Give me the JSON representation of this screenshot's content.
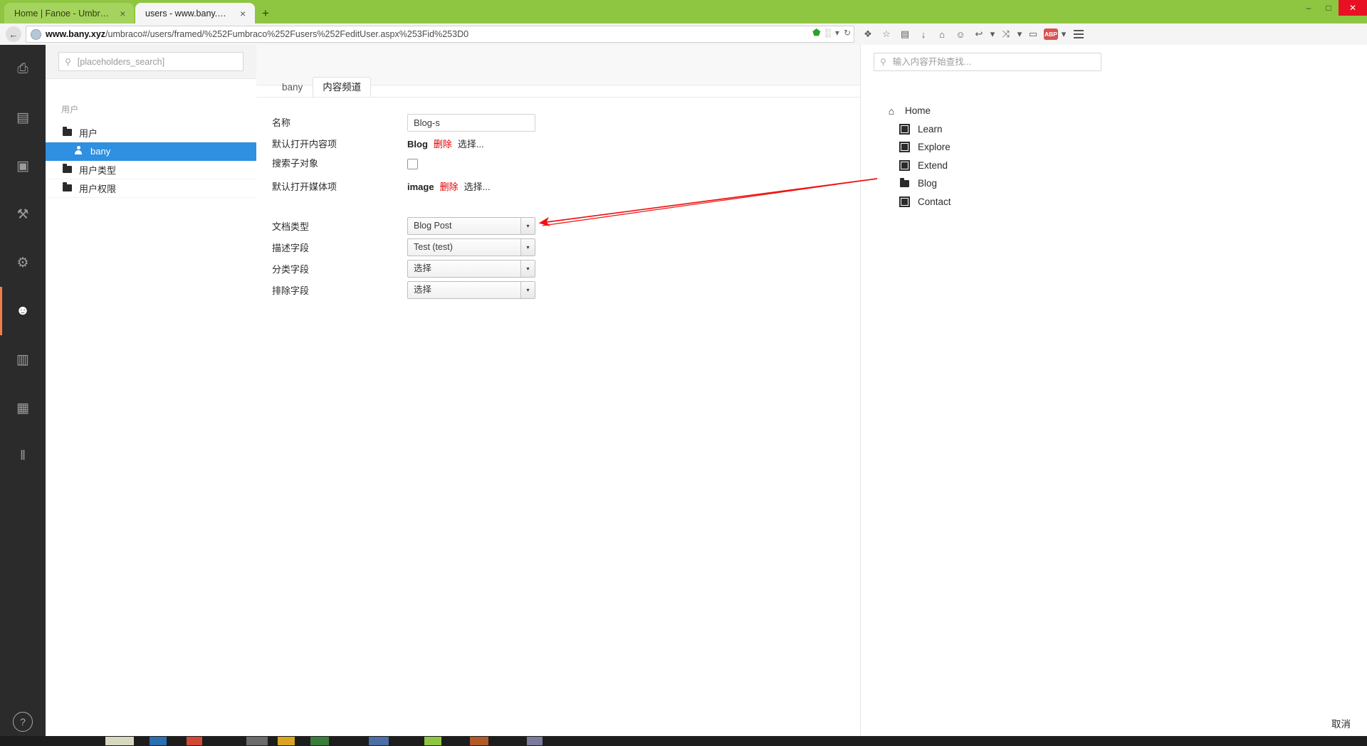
{
  "browser": {
    "tabs": [
      {
        "title": "Home | Fanoe - Umbraco St...",
        "active": false,
        "close": "×"
      },
      {
        "title": "users - www.bany.xyz",
        "active": true,
        "close": "×"
      }
    ],
    "new_tab_label": "+",
    "window_controls": {
      "minimize": "–",
      "maximize": "□",
      "close": "✕"
    },
    "back_arrow": "←",
    "url_bold": "www.bany.xyz",
    "url_rest": "/umbraco#/users/framed/%252Fumbraco%252Fusers%252FeditUser.aspx%253Fid%253D0",
    "omni_icons": {
      "shield": "⬟",
      "grid": "░",
      "dropdown": "▾",
      "reload": "↻"
    },
    "toolbar_icons": {
      "extension": "❖",
      "star": "☆",
      "clipboard": "▤",
      "download": "↓",
      "home": "⌂",
      "smiley": "☺",
      "undo": "↩",
      "undo_caret": "▾",
      "translate": "⤨",
      "caret": "▾",
      "chat": "▭",
      "adblock": "ABP",
      "adblock_caret": "▾"
    }
  },
  "umbraco_nav": {
    "items": [
      {
        "name": "content-section",
        "glyph": "⎙",
        "active": false
      },
      {
        "name": "media-section",
        "glyph": "▤",
        "active": false
      },
      {
        "name": "images-section",
        "glyph": "▣",
        "active": false
      },
      {
        "name": "settings-section",
        "glyph": "⚒",
        "active": false
      },
      {
        "name": "developer-section",
        "glyph": "⚙",
        "active": false
      },
      {
        "name": "users-section",
        "glyph": "☻",
        "active": true
      },
      {
        "name": "members-section",
        "glyph": "▥",
        "active": false
      },
      {
        "name": "forms-section",
        "glyph": "▦",
        "active": false
      },
      {
        "name": "analytics-section",
        "glyph": "‖",
        "active": false
      }
    ],
    "help_glyph": "?"
  },
  "tree_panel": {
    "search": {
      "placeholder": "[placeholders_search]",
      "value": "",
      "icon": "⚲"
    },
    "header": "用户",
    "items": [
      {
        "label": "用户",
        "icon": "folder",
        "selected": false,
        "child": false
      },
      {
        "label": "bany",
        "icon": "user",
        "selected": true,
        "child": true
      },
      {
        "label": "用户类型",
        "icon": "folder",
        "selected": false,
        "child": false
      },
      {
        "label": "用户权限",
        "icon": "folder",
        "selected": false,
        "child": false
      }
    ]
  },
  "main": {
    "tabs": [
      {
        "label": "bany",
        "active": false
      },
      {
        "label": "内容频道",
        "active": true
      }
    ],
    "fields": {
      "name": {
        "label": "名称",
        "value": "Blog-s",
        "placeholder": ""
      },
      "default_content": {
        "label": "默认打开内容项",
        "value": "Blog",
        "remove": "删除",
        "pick": "选择..."
      },
      "search_children": {
        "label": "搜索子对象",
        "checked": false
      },
      "default_media": {
        "label": "默认打开媒体项",
        "value": "image",
        "remove": "删除",
        "pick": "选择..."
      },
      "doc_type": {
        "label": "文档类型",
        "value": "Blog Post"
      },
      "desc_field": {
        "label": "描述字段",
        "value": "Test (test)"
      },
      "category_field": {
        "label": "分类字段",
        "value": "选择"
      },
      "exclude_field": {
        "label": "排除字段",
        "value": "选择"
      }
    },
    "select_arrow": "▾"
  },
  "right_panel": {
    "search": {
      "placeholder": "输入内容开始查找...",
      "value": "",
      "icon": "⚲"
    },
    "items": [
      {
        "label": "Home",
        "icon": "home",
        "child": false
      },
      {
        "label": "Learn",
        "icon": "doc",
        "child": true
      },
      {
        "label": "Explore",
        "icon": "doc",
        "child": true
      },
      {
        "label": "Extend",
        "icon": "doc",
        "child": true
      },
      {
        "label": "Blog",
        "icon": "folder",
        "child": true
      },
      {
        "label": "Contact",
        "icon": "doc",
        "child": true
      }
    ],
    "cancel": "取消"
  },
  "annotation": {
    "arrow_color": "#ee1111"
  }
}
